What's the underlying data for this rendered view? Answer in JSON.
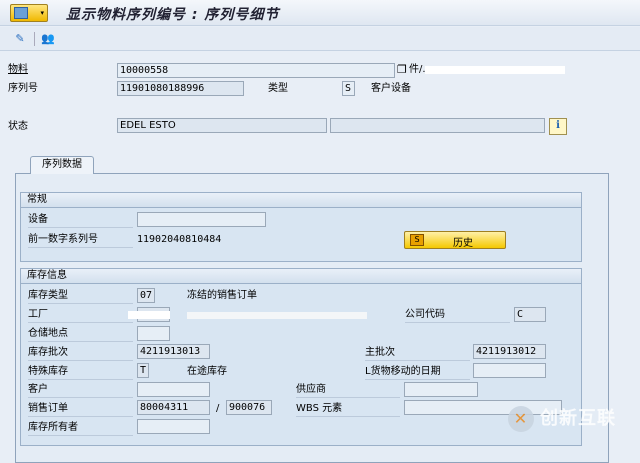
{
  "window": {
    "title": "显示物料序列编号 : 序列号细节"
  },
  "toolbar": {
    "icons": [
      "change-display-icon",
      "users-icon"
    ]
  },
  "header": {
    "material_label": "物料",
    "material_value": "10000558",
    "material_desc": "件/...",
    "serial_label": "序列号",
    "serial_value": "11901080188996",
    "type_label": "类型",
    "type_value": "S",
    "type_desc": "客户设备",
    "status_label": "状态",
    "status_value": "EDEL ESTO",
    "status_value2": "",
    "info_icon": "i"
  },
  "tabs": [
    {
      "label": "序列数据"
    }
  ],
  "general": {
    "title": "常规",
    "equipment_label": "设备",
    "equipment_value": "",
    "prev_serial_label": "前一数字系列号",
    "prev_serial_value": "11902040810484",
    "history_button": "历史"
  },
  "stock": {
    "title": "库存信息",
    "stock_type_label": "库存类型",
    "stock_type_value": "07",
    "stock_type_desc": "冻结的销售订单",
    "plant_label": "工厂",
    "plant_value": "",
    "plant_desc": "",
    "company_code_label": "公司代码",
    "company_code_value": "C",
    "storage_label": "仓储地点",
    "storage_value": "",
    "batch_label": "库存批次",
    "batch_value": "4211913013",
    "master_batch_label": "主批次",
    "master_batch_value": "4211913012",
    "special_stock_label": "特殊库存",
    "special_stock_value": "T",
    "special_stock_desc": "在途库存",
    "last_move_label": "L货物移动的日期",
    "last_move_value": "",
    "customer_label": "客户",
    "customer_value": "",
    "vendor_label": "供应商",
    "vendor_value": "",
    "sales_order_label": "销售订单",
    "sales_order_value": "80004311",
    "sales_order_sep": "/",
    "sales_item_value": "900076",
    "wbs_label": "WBS 元素",
    "wbs_value": "",
    "owner_label": "库存所有者",
    "owner_value": ""
  },
  "watermark": {
    "text": "创新互联"
  }
}
